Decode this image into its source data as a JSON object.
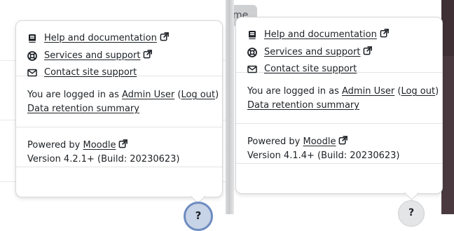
{
  "left": {
    "links": [
      {
        "icon": "book-icon",
        "label": "Help and documentation"
      },
      {
        "icon": "lifebuoy-icon",
        "label": "Services and support"
      },
      {
        "icon": "envelope-icon",
        "label": "Contact site support"
      }
    ],
    "login_prefix": "You are logged in as ",
    "user_name": "Admin User",
    "logout_open": " (",
    "logout_label": "Log out",
    "logout_close": ")",
    "retention_label": "Data retention summary",
    "powered_prefix": "Powered by ",
    "moodle_label": "Moodle",
    "version": "Version 4.2.1+ (Build: 20230623)",
    "help_button_label": "?"
  },
  "right": {
    "links": [
      {
        "icon": "book-icon",
        "label": "Help and documentation"
      },
      {
        "icon": "lifebuoy-icon",
        "label": "Services and support"
      },
      {
        "icon": "envelope-icon",
        "label": "Contact site support"
      }
    ],
    "login_prefix": "You are logged in as ",
    "user_name": "Admin User",
    "logout_open": " (",
    "logout_label": "Log out",
    "logout_close": ")",
    "retention_label": "Data retention summary",
    "powered_prefix": "Powered by ",
    "moodle_label": "Moodle",
    "version": "Version 4.1.4+ (Build: 20230623)",
    "help_button_label": "?",
    "peek_chip_text": "me"
  },
  "colors": {
    "text": "#1d2125",
    "border": "#d6d7d9",
    "help_button_left": "#c7d3e6",
    "help_button_left_ring": "#6d8cc0",
    "help_button_right": "#e4e5e7",
    "dark_background": "#3f3035"
  }
}
